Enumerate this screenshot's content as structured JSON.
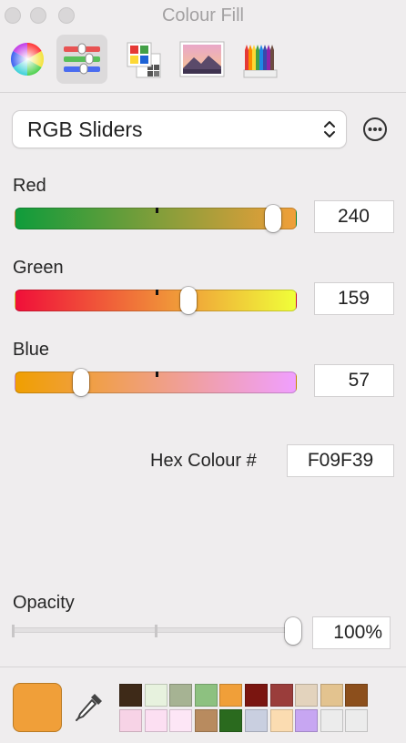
{
  "window": {
    "title": "Colour Fill"
  },
  "toolbar": {
    "buttons": [
      {
        "name": "colour-wheel",
        "icon": "colour-wheel-icon"
      },
      {
        "name": "colour-sliders",
        "icon": "sliders-icon",
        "active": true
      },
      {
        "name": "colour-palettes",
        "icon": "palettes-icon"
      },
      {
        "name": "image-palettes",
        "icon": "image-icon"
      },
      {
        "name": "pencils",
        "icon": "pencils-icon"
      }
    ]
  },
  "mode_select": {
    "selected": "RGB Sliders"
  },
  "sliders": {
    "red": {
      "label": "Red",
      "value": "240",
      "gradient": [
        "#0f9c3b",
        "#f09f39"
      ]
    },
    "green": {
      "label": "Green",
      "value": "159",
      "gradient": [
        "#f00f39",
        "#f0ff39"
      ]
    },
    "blue": {
      "label": "Blue",
      "value": "57",
      "gradient": [
        "#f09f00",
        "#f09fff"
      ]
    }
  },
  "hex": {
    "label": "Hex Colour #",
    "value": "F09F39"
  },
  "opacity": {
    "label": "Opacity",
    "value": "100%",
    "level": 1.0
  },
  "current_colour": "#f09f39",
  "recent_swatches": [
    [
      "#3e2a18",
      "#e7f2de",
      "#a6b393",
      "#8dc180",
      "#f09f39",
      "#7a1510",
      "#9a3d3b",
      "#e3d3bd",
      "#e3c38f",
      "#8c4f1c"
    ],
    [
      "#f7d3e6",
      "#fcdff2",
      "#fde6f6",
      "#b88b5f",
      "#2a6a1e",
      "#c9cfe0",
      "#fbdcb1",
      "#c7a6f2",
      "#ececec",
      "#ececec"
    ]
  ]
}
